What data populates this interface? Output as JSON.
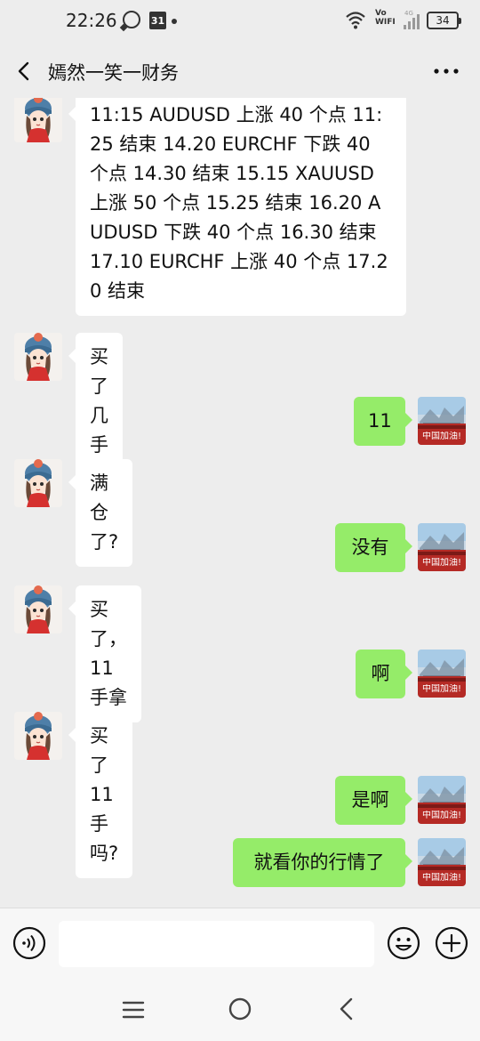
{
  "status_bar": {
    "time": "22:26",
    "calendar_day": "31",
    "network_label": "Vo\nWIFI",
    "signal_label": "4G",
    "battery": "34"
  },
  "header": {
    "title": "嫣然一笑一财务"
  },
  "messages": [
    {
      "side": "left",
      "text": "11:15  AUDUSD 上涨 40 个点 11:25 结束  14.20  EURCHF 下跌 40 个点 14.30 结束  15.15  XAUUSD 上涨 50 个点 15.25 结束  16.20  AUDUSD 下跌 40 个点 16.30 结束  17.10  EURCHF 上涨 40 个点 17.20 结束"
    },
    {
      "side": "left",
      "text": "买了几手"
    },
    {
      "side": "right",
      "text": "11"
    },
    {
      "side": "left",
      "text": "满仓了?"
    },
    {
      "side": "right",
      "text": "没有"
    },
    {
      "side": "left",
      "text": "买了，11 手拿"
    },
    {
      "side": "right",
      "text": "啊"
    },
    {
      "side": "left",
      "text": "买了 11 手吗?"
    },
    {
      "side": "right",
      "text": "是啊"
    },
    {
      "side": "right",
      "text": "就看你的行情了"
    }
  ],
  "my_avatar_caption": "中国加油!",
  "input": {
    "value": "",
    "placeholder": ""
  },
  "colors": {
    "background": "#ededed",
    "my_bubble": "#95ec69",
    "their_bubble": "#ffffff"
  },
  "icons": [
    "back-icon",
    "more-icon",
    "voice-icon",
    "emoji-icon",
    "plus-icon",
    "nav-menu-icon",
    "nav-home-icon",
    "nav-back-icon"
  ]
}
